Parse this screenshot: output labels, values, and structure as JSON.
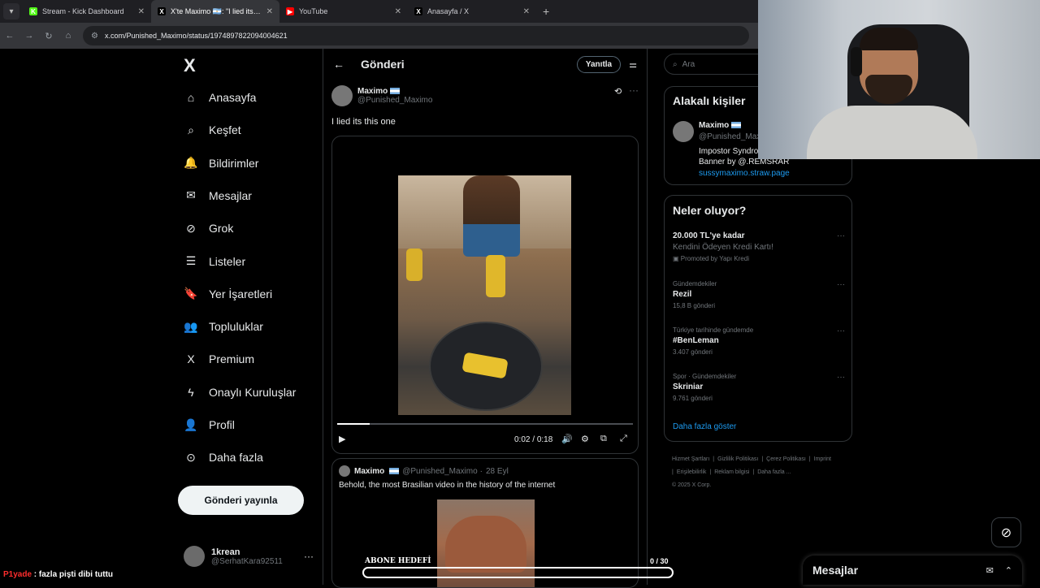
{
  "browser": {
    "tabs": [
      {
        "title": "Stream - Kick Dashboard",
        "favicon_color": "#53fc18",
        "favicon_letter": "K"
      },
      {
        "title": "X'te Maximo 🇦🇷: \"I lied its this o",
        "favicon_color": "#000000",
        "favicon_letter": "X",
        "active": true
      },
      {
        "title": "YouTube",
        "favicon_color": "#ff0000",
        "favicon_letter": "▶"
      },
      {
        "title": "Anasayfa / X",
        "favicon_color": "#000000",
        "favicon_letter": "X"
      }
    ],
    "url": "x.com/Punished_Maximo/status/1974897822094004621"
  },
  "nav": {
    "logo": "X",
    "items": [
      {
        "label": "Anasayfa",
        "icon": "home-icon"
      },
      {
        "label": "Keşfet",
        "icon": "search-icon"
      },
      {
        "label": "Bildirimler",
        "icon": "bell-icon"
      },
      {
        "label": "Mesajlar",
        "icon": "envelope-icon"
      },
      {
        "label": "Grok",
        "icon": "grok-icon"
      },
      {
        "label": "Listeler",
        "icon": "list-icon"
      },
      {
        "label": "Yer İşaretleri",
        "icon": "bookmark-icon"
      },
      {
        "label": "Topluluklar",
        "icon": "people-icon"
      },
      {
        "label": "Premium",
        "icon": "x-icon"
      },
      {
        "label": "Onaylı Kuruluşlar",
        "icon": "lightning-icon"
      },
      {
        "label": "Profil",
        "icon": "person-icon"
      },
      {
        "label": "Daha fazla",
        "icon": "more-circle-icon"
      }
    ],
    "post_button": "Gönderi yayınla",
    "account": {
      "name": "1krean",
      "handle": "@SerhatKara92511"
    }
  },
  "post": {
    "header_title": "Gönderi",
    "reply_button": "Yanıtla",
    "author_name": "Maximo",
    "author_handle": "@Punished_Maximo",
    "text": "I lied its this one",
    "video": {
      "current_time": "0:02",
      "duration": "0:18",
      "progress": 0.11
    }
  },
  "quote": {
    "author_name": "Maximo",
    "author_handle": "@Punished_Maximo",
    "date": "28 Eyl",
    "text": "Behold, the most Brasilian video in the history of the internet"
  },
  "search": {
    "placeholder": "Ara"
  },
  "related": {
    "title": "Alakalı kişiler",
    "person": {
      "name": "Maximo",
      "handle": "@Punished_Max",
      "bio_line1": "Impostor Syndro",
      "bio_line2": "Banner by @.REMSRAR",
      "link": "sussymaximo.straw.page"
    }
  },
  "trends": {
    "title": "Neler oluyor?",
    "promo": {
      "title": "20.000 TL'ye kadar",
      "subtitle": "Kendini Ödeyen Kredi Kartı!",
      "by": "Promoted by Yapı Kredi"
    },
    "items": [
      {
        "meta": "Gündemdekiler",
        "name": "Rezil",
        "count": "15,8 B gönderi"
      },
      {
        "meta": "Türkiye tarihinde gündemde",
        "name": "#BenLeman",
        "count": "3.407 gönderi"
      },
      {
        "meta": "Spor · Gündemdekiler",
        "name": "Skriniar",
        "count": "9.761 gönderi"
      }
    ],
    "show_more": "Daha fazla göster"
  },
  "footer": {
    "links": [
      "Hizmet Şartları",
      "|",
      "Gizlilik Politikası",
      "|",
      "Çerez Politikası",
      "|",
      "Imprint",
      "|",
      "Erişilebilirlik",
      "|",
      "Reklam bilgisi",
      "|",
      "Daha fazla ...",
      "© 2025 X Corp."
    ]
  },
  "overlay": {
    "chat_user": "P1yade",
    "chat_message": " : fazla pişti dibi tuttu",
    "goal_label": "ABONE HEDEFİ",
    "goal_current": "0",
    "goal_target": "/ 30"
  },
  "messages_dock": {
    "title": "Mesajlar"
  }
}
